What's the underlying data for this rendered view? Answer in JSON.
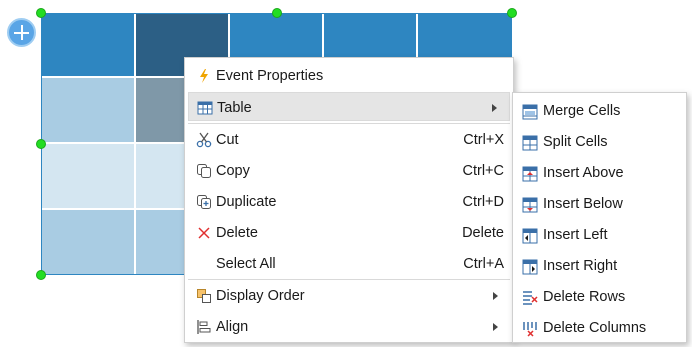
{
  "table": {
    "colors": {
      "header": "#2e86c1",
      "header_selected": "#2c5f85",
      "row1": "#a9cce3",
      "row1_selected": "#7f98a8",
      "row2": "#d4e6f1",
      "row3": "#a9cce3",
      "handle": "#22dd22",
      "add_button": "#5aa5e6"
    }
  },
  "menu": {
    "items": [
      {
        "label": "Event Properties",
        "icon": "lightning-icon"
      },
      {
        "label": "Table",
        "icon": "table-icon",
        "has_submenu": true
      },
      {
        "label": "Cut",
        "shortcut": "Ctrl+X",
        "icon": "scissors-icon"
      },
      {
        "label": "Copy",
        "shortcut": "Ctrl+C",
        "icon": "copy-icon"
      },
      {
        "label": "Duplicate",
        "shortcut": "Ctrl+D",
        "icon": "duplicate-icon"
      },
      {
        "label": "Delete",
        "shortcut": "Delete",
        "icon": "delete-x-icon"
      },
      {
        "label": "Select All",
        "shortcut": "Ctrl+A"
      },
      {
        "label": "Display Order",
        "icon": "display-order-icon",
        "has_submenu": true
      },
      {
        "label": "Align",
        "icon": "align-icon",
        "has_submenu": true
      }
    ]
  },
  "submenu": {
    "items": [
      {
        "label": "Merge Cells",
        "icon": "merge-cells-icon"
      },
      {
        "label": "Split Cells",
        "icon": "split-cells-icon"
      },
      {
        "label": "Insert Above",
        "icon": "insert-above-icon"
      },
      {
        "label": "Insert Below",
        "icon": "insert-below-icon"
      },
      {
        "label": "Insert Left",
        "icon": "insert-left-icon"
      },
      {
        "label": "Insert Right",
        "icon": "insert-right-icon"
      },
      {
        "label": "Delete Rows",
        "icon": "delete-rows-icon"
      },
      {
        "label": "Delete Columns",
        "icon": "delete-columns-icon"
      }
    ]
  }
}
